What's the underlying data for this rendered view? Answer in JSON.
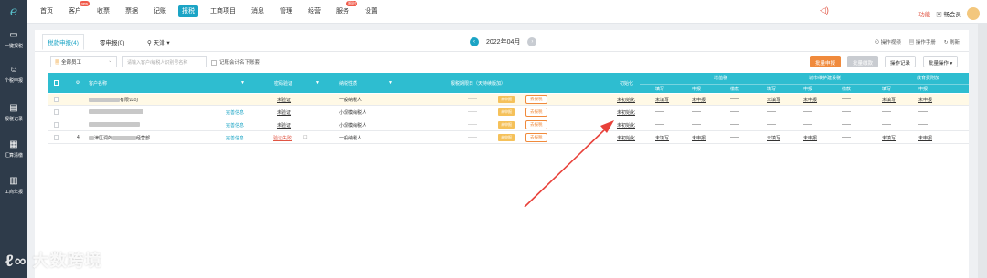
{
  "topbar": {
    "logo_glyph": "e",
    "nav": [
      {
        "label": "首页"
      },
      {
        "label": "客户",
        "badge": "new"
      },
      {
        "label": "收票"
      },
      {
        "label": "票据"
      },
      {
        "label": "记账"
      },
      {
        "label": "报税",
        "active": true
      },
      {
        "label": "工商项目"
      },
      {
        "label": "消息"
      },
      {
        "label": "管理"
      },
      {
        "label": "经营"
      },
      {
        "label": "服务",
        "badge": "限时"
      },
      {
        "label": "设置"
      }
    ],
    "func_label": "功能",
    "member_label": "畅会员"
  },
  "sidebar": [
    {
      "label": "一键报税",
      "icon": "laptop-icon"
    },
    {
      "label": "个税申报",
      "icon": "person-icon"
    },
    {
      "label": "报税记录",
      "icon": "record-icon"
    },
    {
      "label": "汇算清缴",
      "icon": "calc-icon"
    },
    {
      "label": "工商年报",
      "icon": "report-icon"
    }
  ],
  "tabs": [
    {
      "label": "税款申报(4)",
      "active": true
    },
    {
      "label": "零申报(0)"
    },
    {
      "label": "天津 ▾"
    }
  ],
  "month": "2022年04月",
  "links": [
    "操作视频",
    "操作手册",
    "刷新"
  ],
  "toolbar": {
    "employee_select": "全部员工",
    "search_placeholder": "请输入客户/纳税人识别号名称",
    "checkbox_label": "记账会计名下账套",
    "batch_declare": "批量申报",
    "batch_pay": "批量缴款",
    "op_log": "操作记录",
    "batch_ops": "批量操作 ▾"
  },
  "table": {
    "headers": {
      "customer": "客户名称",
      "verify": "密码验证",
      "taxpayer_type": "纳税性质",
      "declare_period": "报税期限日（天持续版加）",
      "init": "初始化",
      "vat": "增值税",
      "city_tax": "城市维护建设税",
      "edu": "教育费附加"
    },
    "sub_headers": [
      "填写",
      "申报",
      "缴款"
    ],
    "rows": [
      {
        "num": "",
        "name_suffix": "有限公司",
        "info": "",
        "verify": "未验证",
        "type": "一般纳税人",
        "tag": "未申报",
        "btn": "去报税",
        "init": "未初始化",
        "v1": "未填写",
        "v2": "未申报",
        "v3": "——",
        "c1": "未填写",
        "c2": "未申报",
        "c3": "——",
        "e1": "未填写",
        "e2": "未申报",
        "highlight": true
      },
      {
        "num": "",
        "name_suffix": "",
        "info": "完善信息",
        "verify": "未验证",
        "type": "小规模纳税人",
        "tag": "未申报",
        "btn": "去报税",
        "init": "未初始化",
        "v1": "——",
        "v2": "——",
        "v3": "——",
        "c1": "——",
        "c2": "——",
        "c3": "——",
        "e1": "——",
        "e2": "——"
      },
      {
        "num": "",
        "name_suffix": "",
        "info": "完善信息",
        "verify": "未验证",
        "type": "小规模纳税人",
        "tag": "未申报",
        "btn": "去报税",
        "init": "未初始化",
        "v1": "——",
        "v2": "——",
        "v3": "——",
        "c1": "——",
        "c2": "——",
        "c3": "——",
        "e1": "——",
        "e2": "——"
      },
      {
        "num": "4",
        "name_suffix": "经营部",
        "name_prefix": "津区润的",
        "info": "完善信息",
        "verify": "验证失败",
        "type": "一般纳税人",
        "tag": "未申报",
        "btn": "去报税",
        "init": "未初始化",
        "v1": "未填写",
        "v2": "未申报",
        "v3": "——",
        "c1": "未填写",
        "c2": "未申报",
        "c3": "——",
        "e1": "未填写",
        "e2": "未申报"
      }
    ],
    "dash": "——"
  },
  "watermark": "大数跨境",
  "colors": {
    "accent": "#1ba4c5",
    "header": "#2ebdd0",
    "sidebar": "#2e3b4a",
    "orange": "#f08a3c",
    "arrow": "#e8413a"
  }
}
